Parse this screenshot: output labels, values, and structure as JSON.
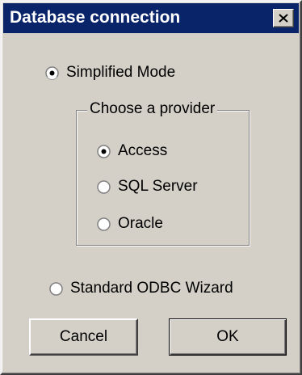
{
  "dialog": {
    "title": "Database connection",
    "close_icon": "close-icon"
  },
  "mode": {
    "simplified_label": "Simplified Mode",
    "standard_label": "Standard ODBC Wizard",
    "selected": "simplified"
  },
  "provider": {
    "group_label": "Choose a provider",
    "options": [
      "Access",
      "SQL Server",
      "Oracle"
    ],
    "selected": "Access"
  },
  "buttons": {
    "cancel_label": "Cancel",
    "ok_label": "OK"
  },
  "colors": {
    "titlebar": "#0a246a",
    "face": "#d4d0c8"
  }
}
